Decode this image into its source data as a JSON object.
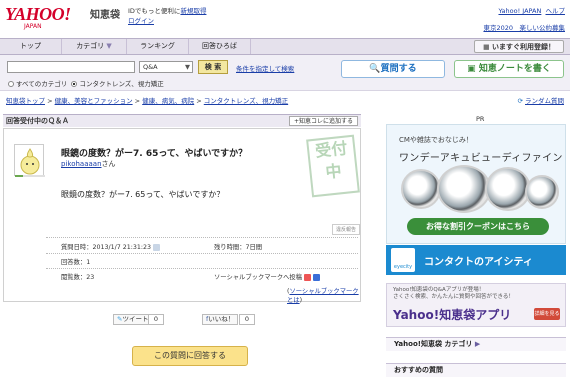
{
  "header": {
    "logo": "YAHOO!",
    "logo_sub": "JAPAN",
    "service": "知恵袋",
    "line1_text": "IDでもっと便利に",
    "signup": "新規取得",
    "login": "ログイン",
    "yahoo_link": "Yahoo! JAPAN",
    "help_link": "ヘルプ",
    "promo_link": "東京2020　楽しい公約募集"
  },
  "nav": {
    "items": [
      "トップ",
      "カテゴリ",
      "ランキング",
      "回答ひろば"
    ],
    "register": "いますぐ利用登録！"
  },
  "search": {
    "placeholder": "",
    "select_value": "Q&A",
    "button": "検 索",
    "conditions_link": "条件を指定して検索",
    "radio_all": "すべてのカテゴリ",
    "radio_cat": "コンタクトレンズ、視力矯正",
    "ask_button": "質問する",
    "note_button": "知恵ノートを書く"
  },
  "breadcrumb": {
    "items": [
      "知恵袋トップ",
      "健康、美容とファッション",
      "健康、病気、病院",
      "コンタクトレンズ、視力矯正"
    ],
    "ranking": "ランダム質問"
  },
  "question": {
    "section_title": "回答受付中のＱ＆Ａ",
    "add_button": "知恵コレに追加する",
    "title": "眼鏡の度数？がー7. 65って、やばいですか？",
    "user": "pikohaaaan",
    "user_suffix": "さん",
    "body": "眼鏡の度数？がー7. 65って、やばいですか？",
    "stamp": "受付中",
    "report": "違反報告",
    "date_label": "質問日時：",
    "date_value": "2013/1/7 21:31:23",
    "remaining_label": "残り時間：",
    "remaining_value": "7日間",
    "answers_label": "回答数：",
    "answers_value": "1",
    "views_label": "閲覧数：",
    "views_value": "23",
    "social_label": "ソーシャルブックマークへ投稿",
    "social_link": "ソーシャルブックマークとは",
    "tweet": "ツイート",
    "tweet_count": "0",
    "like": "いいね！",
    "like_count": "0",
    "answer_button": "この質問に回答する"
  },
  "sidebar": {
    "pr": "PR",
    "ad1_line1": "CMや雑誌でおなじみ！",
    "ad1_line2": "ワンデーアキュビューディファイン",
    "ad1_coupon": "お得な割引クーポンはこちら",
    "ad2_brand": "eyecity",
    "ad2_text": "コンタクトのアイシティ",
    "ad3_line1": "Yahoo!知恵袋のQ&Aアプリが登場！",
    "ad3_line2": "さくさく検索、かんたんに質問や回答ができる！",
    "ad3_title": "Yahoo!知恵袋アプリ",
    "ad3_badge": "詳細を見る",
    "category_head": "Yahoo!知恵袋 カテゴリ",
    "recommended_head": "おすすめの質問"
  },
  "colors": {
    "accent": "#d4002a",
    "link": "#1a3ea8",
    "nav_bg": "#e5e1ec"
  }
}
